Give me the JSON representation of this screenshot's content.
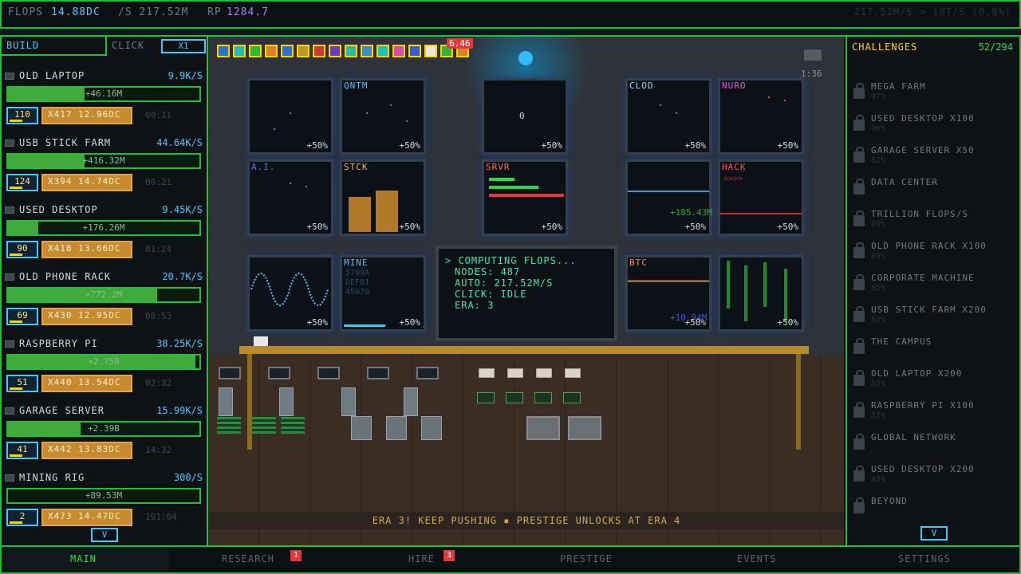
{
  "topbar": {
    "flops_label": "FLOPS",
    "flops_value": "14.88DC",
    "per_sec": "/S 217.52M",
    "rp_label": "RP",
    "rp_value": "1284.7",
    "right_text": "217.52M/S > 10T/S (0.0%)"
  },
  "left": {
    "tab_build": "BUILD",
    "tab_click": "CLICK",
    "multiplier": "X1",
    "scroll_down": "V",
    "items": [
      {
        "name": "OLD LAPTOP",
        "rate": "9.9K/S",
        "bar": "+46.16M",
        "fill": 0.4,
        "count": "110",
        "buy": "X417 12.96DC",
        "time": "00:11"
      },
      {
        "name": "USB STICK FARM",
        "rate": "44.64K/S",
        "bar": "+416.32M",
        "fill": 0.4,
        "count": "124",
        "buy": "X394 14.74DC",
        "time": "00:21"
      },
      {
        "name": "USED DESKTOP",
        "rate": "9.45K/S",
        "bar": "+176.26M",
        "fill": 0.16,
        "count": "90",
        "buy": "X418 13.66DC",
        "time": "01:24"
      },
      {
        "name": "OLD PHONE RACK",
        "rate": "20.7K/S",
        "bar": "+772.2M",
        "fill": 0.78,
        "count": "69",
        "buy": "X430 12.95DC",
        "time": "00:53"
      },
      {
        "name": "RASPBERRY PI",
        "rate": "38.25K/S",
        "bar": "+2.75B",
        "fill": 0.98,
        "count": "51",
        "buy": "X440 13.54DC",
        "time": "02:32"
      },
      {
        "name": "GARAGE SERVER",
        "rate": "15.99K/S",
        "bar": "+2.39B",
        "fill": 0.38,
        "count": "41",
        "buy": "X442 13.83DC",
        "time": "14:32"
      },
      {
        "name": "MINING RIG",
        "rate": "300/S",
        "bar": "+89.53M",
        "fill": 0.0,
        "count": "2",
        "buy": "X473 14.47DC",
        "time": "191:04"
      }
    ]
  },
  "scene": {
    "counter_badge": "6.46",
    "clock": "1:36",
    "monitors": [
      {
        "label": "",
        "pct": "+50%"
      },
      {
        "label": "QNTM",
        "pct": "+50%"
      },
      {
        "label": "",
        "pct": "+50%",
        "center": "0"
      },
      {
        "label": "CLOD",
        "pct": "+50%"
      },
      {
        "label": "NURO",
        "pct": "+50%"
      },
      {
        "label": "A.I.",
        "pct": "+50%"
      },
      {
        "label": "STCK",
        "pct": "+50%"
      },
      {
        "label": "SRVR",
        "pct": "+50%"
      },
      {
        "label": "",
        "pct": "+50%"
      },
      {
        "label": "HACK",
        "pct": "+50%",
        "sub": ">>>>"
      },
      {
        "label": "",
        "pct": "+50%"
      },
      {
        "label": "MINE",
        "pct": "+50%",
        "hex": "5799A\nDEF01\n45670"
      },
      {
        "label": "BTC",
        "pct": "+50%"
      },
      {
        "label": "",
        "pct": "+50%"
      }
    ],
    "floating_gain_1": "+185.43M",
    "floating_gain_2": "+10.94M",
    "console": {
      "line1": "> COMPUTING FLOPS...",
      "line2": "NODES: 487",
      "line3": "AUTO: 217.52M/S",
      "line4": "CLICK: IDLE",
      "line5": "ERA: 3"
    },
    "banner": "ERA 3! KEEP PUSHING ▪ PRESTIGE UNLOCKS AT ERA 4"
  },
  "right": {
    "title": "CHALLENGES",
    "count": "52/294",
    "scroll_down": "V",
    "items": [
      {
        "name": "MEGA FARM",
        "pct": "97%"
      },
      {
        "name": "USED DESKTOP X100",
        "pct": "90%"
      },
      {
        "name": "GARAGE SERVER X50",
        "pct": "82%"
      },
      {
        "name": "DATA CENTER",
        "pct": ""
      },
      {
        "name": "TRILLION FLOPS/S",
        "pct": "69%"
      },
      {
        "name": "OLD PHONE RACK X100",
        "pct": "69%"
      },
      {
        "name": "CORPORATE MACHINE",
        "pct": "65%"
      },
      {
        "name": "USB STICK FARM X200",
        "pct": "62%"
      },
      {
        "name": "THE CAMPUS",
        "pct": ""
      },
      {
        "name": "OLD LAPTOP X200",
        "pct": "55%"
      },
      {
        "name": "RASPBERRY PI X100",
        "pct": "51%"
      },
      {
        "name": "GLOBAL NETWORK",
        "pct": ""
      },
      {
        "name": "USED DESKTOP X200",
        "pct": "45%"
      },
      {
        "name": "BEYOND",
        "pct": ""
      }
    ]
  },
  "nav": {
    "main": "MAIN",
    "research": "RESEARCH",
    "research_badge": "1",
    "hire": "HIRE",
    "hire_badge": "3",
    "prestige": "PRESTIGE",
    "events": "EVENTS",
    "settings": "SETTINGS"
  },
  "colors": {
    "accent_green": "#1fbf3a",
    "accent_blue": "#45c6ff",
    "buy_orange": "#c88a2e",
    "challenge_yellow": "#ffd200",
    "badge_red": "#e23a3a"
  }
}
